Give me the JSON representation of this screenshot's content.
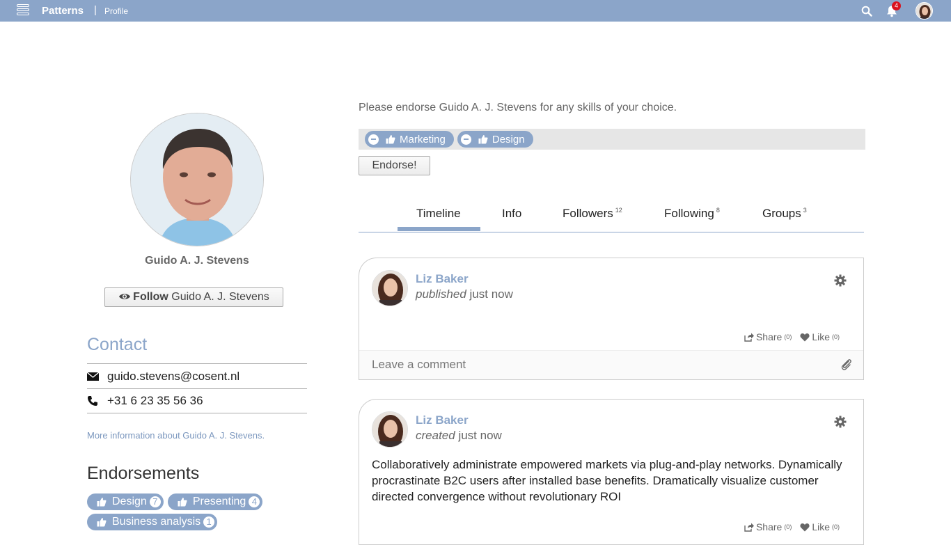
{
  "topbar": {
    "app_title": "Patterns",
    "separator": "|",
    "breadcrumb": "Profile",
    "notification_count": "4",
    "accent_color": "#8ba5c9",
    "badge_color": "#d9121e"
  },
  "profile": {
    "name": "Guido A. J. Stevens",
    "follow_bold": "Follow",
    "follow_rest": "Guido A. J. Stevens"
  },
  "contact": {
    "heading": "Contact",
    "email": "guido.stevens@cosent.nl",
    "phone": "+31 6 23 35 56 36",
    "more_link": "More information about Guido A. J. Stevens."
  },
  "endorsements": {
    "heading": "Endorsements",
    "items": [
      {
        "label": "Design",
        "count": "7"
      },
      {
        "label": "Presenting",
        "count": "4"
      },
      {
        "label": "Business analysis",
        "count": "1"
      }
    ]
  },
  "endorse_form": {
    "prompt": "Please endorse Guido A. J. Stevens for any skills of your choice.",
    "skills": [
      "Marketing",
      "Design"
    ],
    "button": "Endorse!"
  },
  "tabs": [
    {
      "label": "Timeline",
      "count": ""
    },
    {
      "label": "Info",
      "count": ""
    },
    {
      "label": "Followers",
      "count": "12"
    },
    {
      "label": "Following",
      "count": "8"
    },
    {
      "label": "Groups",
      "count": "3"
    }
  ],
  "posts": [
    {
      "author": "Liz Baker",
      "verb": "published",
      "time": "just now",
      "body": "",
      "share_label": "Share",
      "share_count": "(0)",
      "like_label": "Like",
      "like_count": "(0)",
      "comment_placeholder": "Leave a comment"
    },
    {
      "author": "Liz Baker",
      "verb": "created",
      "time": "just now",
      "body": "Collaboratively administrate empowered markets via plug-and-play networks. Dynamically procrastinate B2C users after installed base benefits. Dramatically visualize customer directed convergence without revolutionary ROI",
      "share_label": "Share",
      "share_count": "(0)",
      "like_label": "Like",
      "like_count": "(0)"
    }
  ]
}
